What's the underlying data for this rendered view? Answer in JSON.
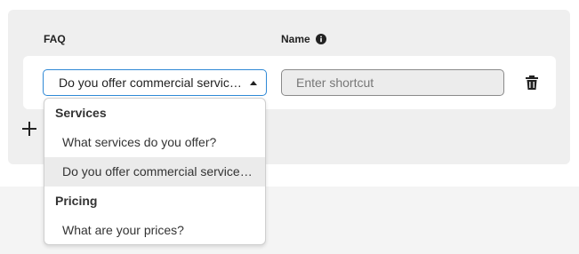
{
  "header": {
    "faq_label": "FAQ",
    "name_label": "Name",
    "name_info_icon": "info-icon"
  },
  "row": {
    "faq_selected": "Do you offer commercial services?",
    "shortcut_value": "",
    "shortcut_placeholder": "Enter shortcut",
    "delete_icon": "trash-icon"
  },
  "add_icon": "plus-icon",
  "dropdown": {
    "groups": [
      {
        "label": "Services",
        "options": [
          "What services do you offer?",
          "Do you offer commercial services?"
        ]
      },
      {
        "label": "Pricing",
        "options": [
          "What are your prices?"
        ]
      }
    ],
    "highlighted_option": "Do you offer commercial services?"
  },
  "colors": {
    "focus_border": "#2f89d6",
    "panel_bg": "#efefef",
    "highlight_bg": "#ebebeb"
  }
}
